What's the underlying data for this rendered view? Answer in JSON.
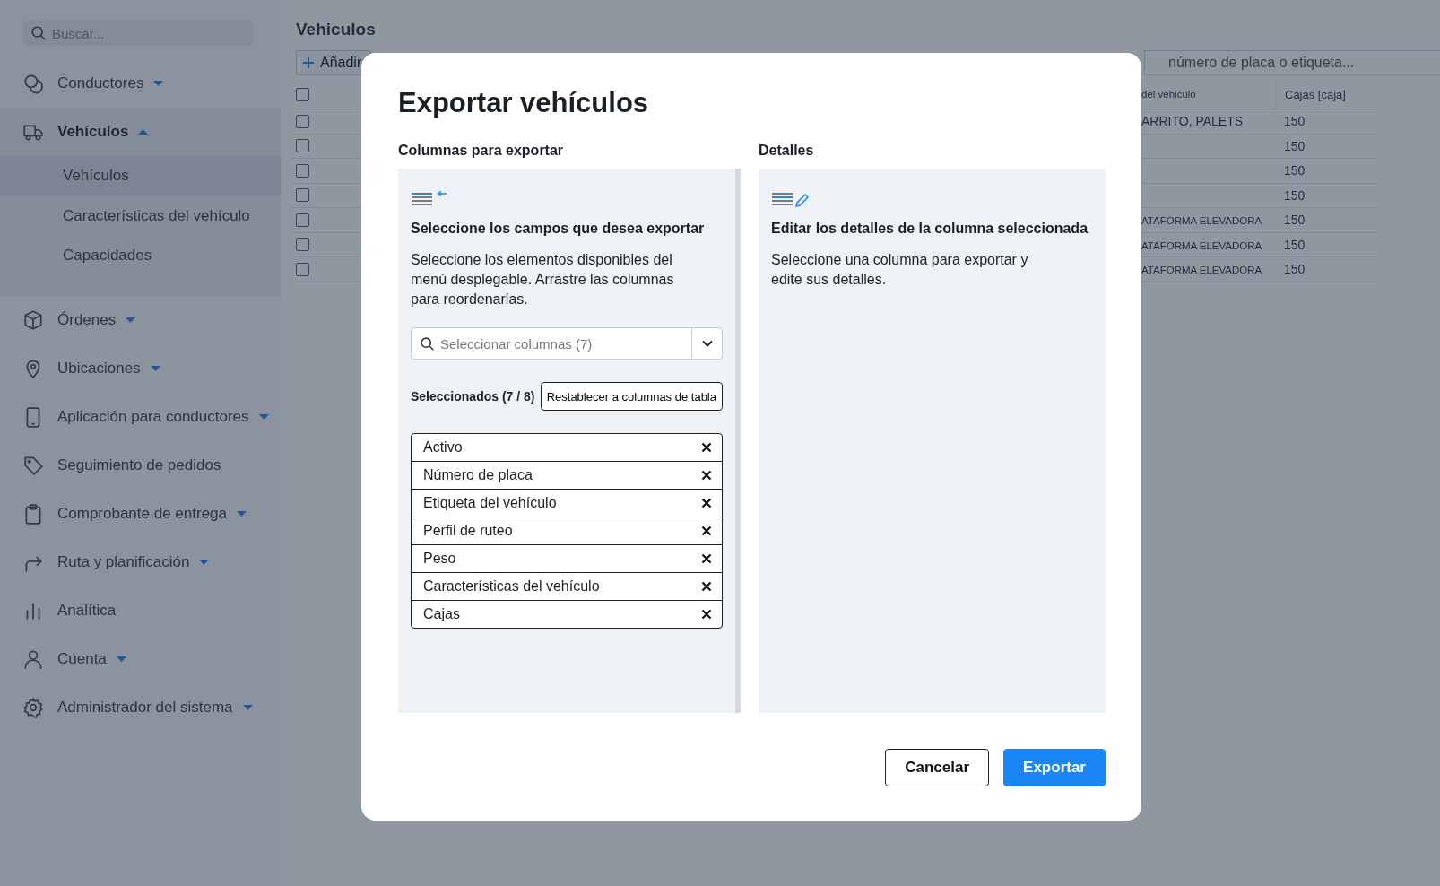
{
  "sidebar": {
    "search": {
      "placeholder": "Buscar..."
    },
    "items": [
      {
        "label": "Conductores",
        "kind": "menu",
        "expanded": false
      },
      {
        "label": "Vehículos",
        "kind": "menu",
        "expanded": true,
        "children": [
          {
            "label": "Vehículos",
            "selected": true
          },
          {
            "label": "Características del vehículo",
            "selected": false
          },
          {
            "label": "Capacidades",
            "selected": false
          }
        ]
      },
      {
        "label": "Órdenes",
        "kind": "menu",
        "expanded": false
      },
      {
        "label": "Ubicaciones",
        "kind": "menu",
        "expanded": false
      },
      {
        "label": "Aplicación para conductores",
        "kind": "menu",
        "expanded": false
      },
      {
        "label": "Seguimiento de pedidos",
        "kind": "link",
        "expanded": false
      },
      {
        "label": "Comprobante de entrega",
        "kind": "menu",
        "expanded": false
      },
      {
        "label": "Ruta y planificación",
        "kind": "menu",
        "expanded": false
      },
      {
        "label": "Analítica",
        "kind": "link",
        "expanded": false
      },
      {
        "label": "Cuenta",
        "kind": "menu",
        "expanded": false
      },
      {
        "label": "Administrador del sistema",
        "kind": "menu",
        "expanded": false
      }
    ]
  },
  "page": {
    "title": "Vehiculos",
    "add_button": "Añadir",
    "search": {
      "placeholder": "número de placa o etiqueta..."
    },
    "table": {
      "header": {
        "checked": false,
        "column_2": "del vehiculo",
        "column_3": "Cajas [caja]"
      },
      "rows": [
        {
          "checked": false,
          "column_2": "ARRITO, PALETS",
          "column_3": "150"
        },
        {
          "checked": false,
          "column_3": "150"
        },
        {
          "checked": false,
          "column_3": "150"
        },
        {
          "checked": false,
          "column_3": "150"
        },
        {
          "checked": false,
          "column_2": "ATAFORMA ELEVADORA",
          "column_3": "150"
        },
        {
          "checked": false,
          "column_2": "ATAFORMA ELEVADORA",
          "column_3": "150"
        },
        {
          "checked": false,
          "column_2": "ATAFORMA ELEVADORA",
          "column_3": "150"
        }
      ]
    }
  },
  "dialog": {
    "title": "Exportar vehículos",
    "columns_section": {
      "label": "Columnas para exportar",
      "heading": "Seleccione los campos que desea exportar",
      "text": "Seleccione los elementos disponibles del menú desplegable. Arrastre las columnas para reordenarlas.",
      "select": {
        "placeholder": "Seleccionar columnas (7)"
      },
      "selected_label": "Seleccionados (7 / 8)",
      "reset_button": "Restablecer a columnas de tabla",
      "selected": [
        "Activo",
        "Número de placa",
        "Etiqueta del vehículo",
        "Perfil de ruteo",
        "Peso",
        "Características del vehículo",
        "Cajas"
      ]
    },
    "details_section": {
      "label": "Detalles",
      "heading": "Editar los detalles de la columna seleccionada",
      "text": "Seleccione una columna para exportar y edite sus detalles."
    },
    "buttons": [
      {
        "label": "Cancelar",
        "kind": "secondary"
      },
      {
        "label": "Exportar",
        "kind": "primary"
      }
    ]
  }
}
